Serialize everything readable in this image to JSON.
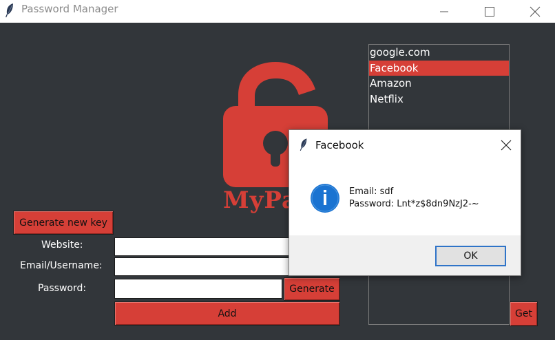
{
  "window": {
    "title": "Password Manager",
    "app_icon": "feather-icon",
    "controls": [
      "minimize-icon",
      "maximize-icon",
      "close-icon"
    ]
  },
  "logo": {
    "icon": "open-padlock-icon",
    "text": "MyPa"
  },
  "form": {
    "generate_key_label": "Generate new key",
    "website_label": "Website:",
    "email_label": "Email/Username:",
    "password_label": "Password:",
    "website_value": "",
    "email_value": "",
    "password_value": "",
    "generate_label": "Generate",
    "add_label": "Add"
  },
  "list": {
    "items": [
      "google.com",
      "Facebook",
      "Amazon",
      "Netflix"
    ],
    "selected_index": 1,
    "get_label": "Get"
  },
  "dialog": {
    "title": "Facebook",
    "icon": "info-icon",
    "email_line": "Email: sdf",
    "password_line": "Password: Lnt*z$8dn9NzJ2-~",
    "ok_label": "OK"
  },
  "colors": {
    "background": "#32363a",
    "accent": "#d63f37",
    "info_blue": "#1a73d1",
    "ok_border": "#2f74c8"
  }
}
